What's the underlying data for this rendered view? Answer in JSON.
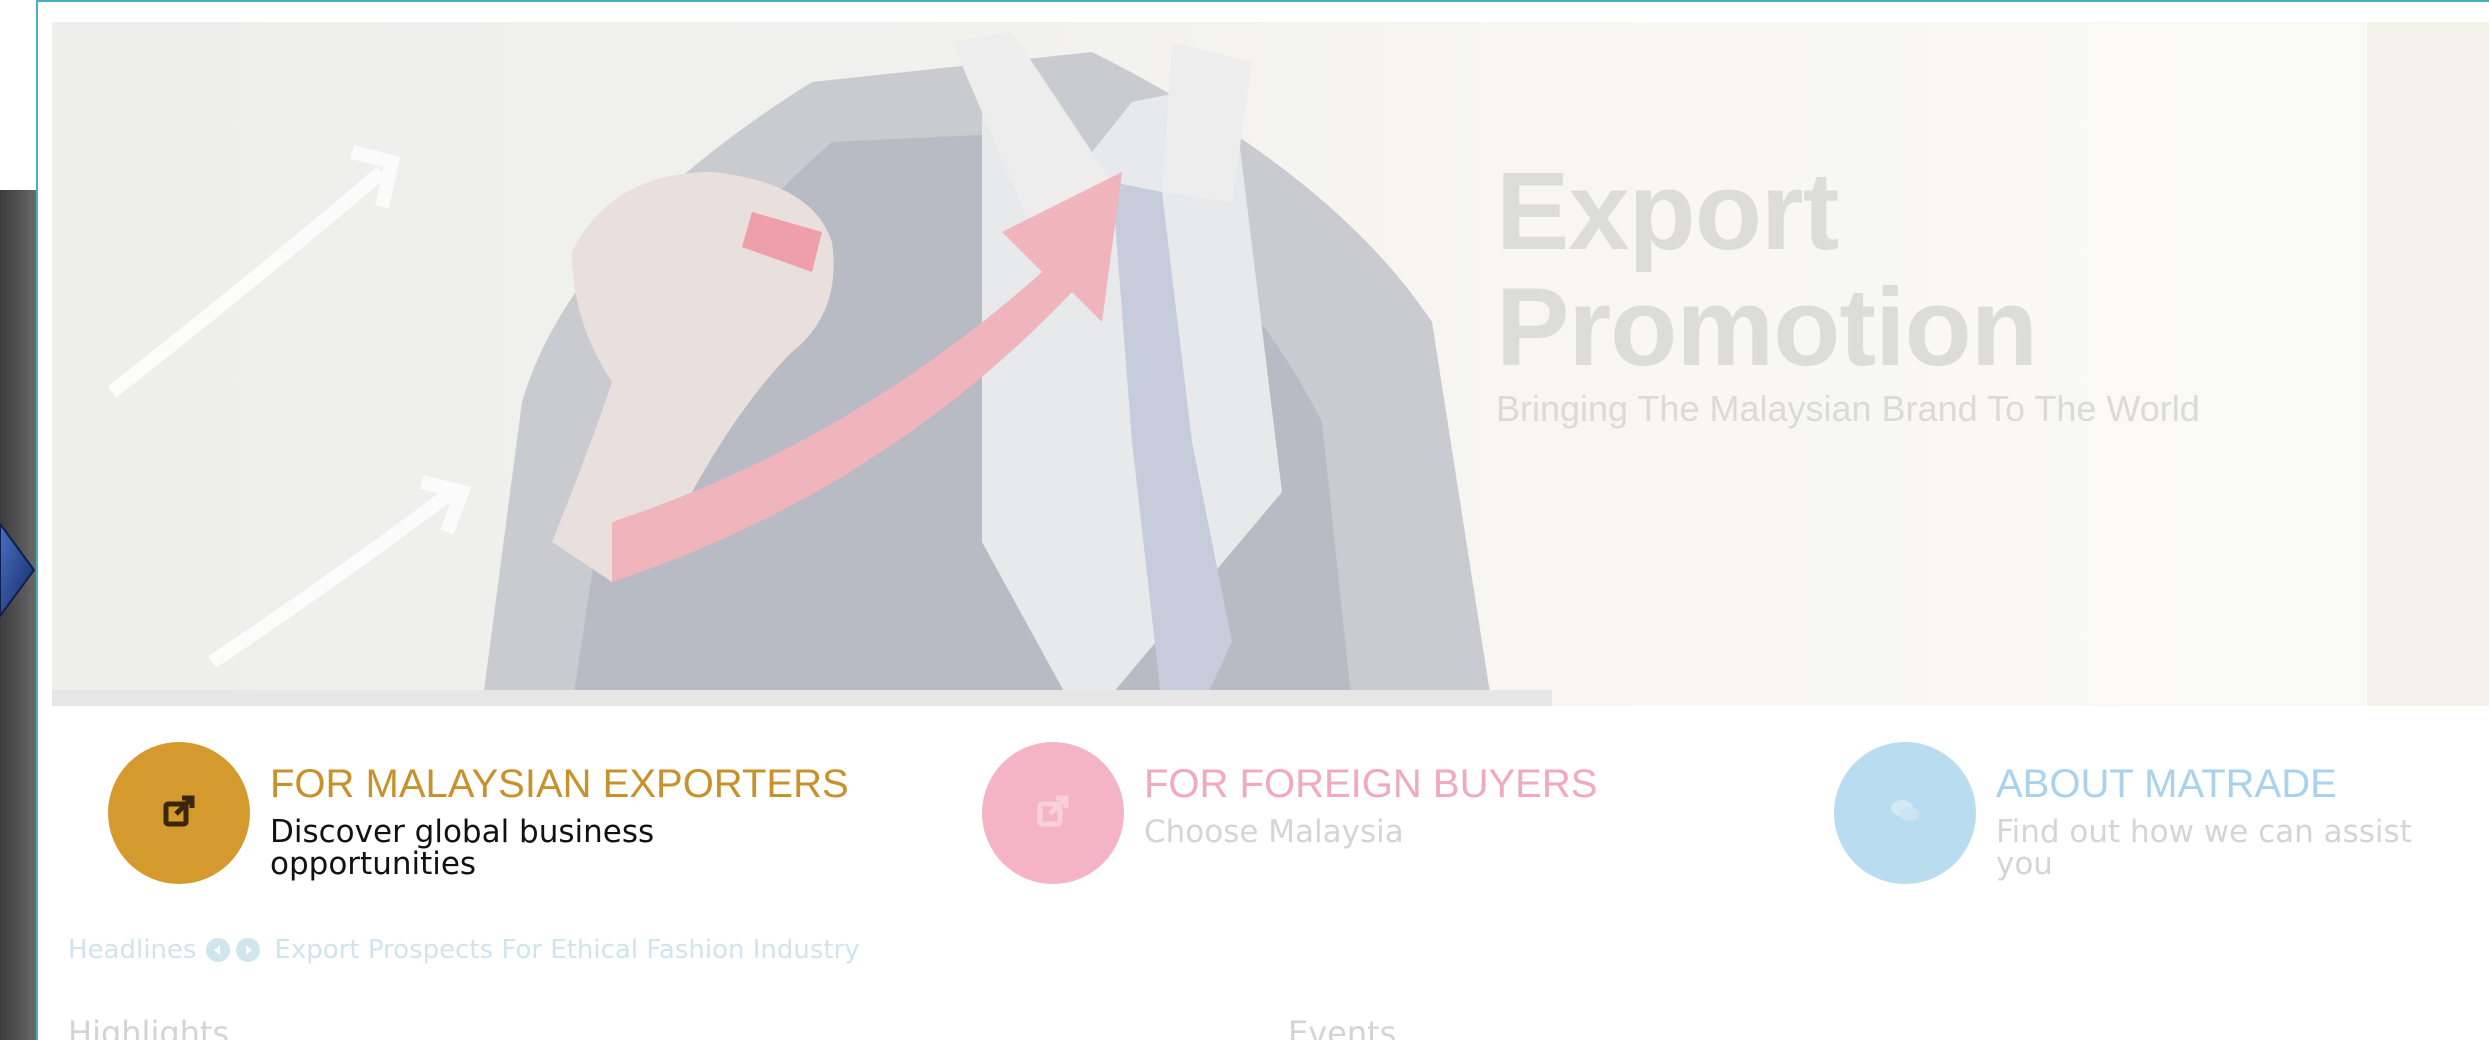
{
  "hero": {
    "title_line1": "Export",
    "title_line2": "Promotion",
    "subtitle": "Bringing The Malaysian Brand To The World"
  },
  "cards": [
    {
      "title": "FOR MALAYSIAN EXPORTERS",
      "description": "Discover global business opportunities",
      "color": "#d59a2d",
      "title_color": "#c9912b",
      "desc_color": "#111111",
      "icon": "external-link-icon"
    },
    {
      "title": "FOR FOREIGN BUYERS",
      "description": "Choose Malaysia",
      "color": "#f4b4c6",
      "title_color": "#f0a9be",
      "desc_color": "#d5d5d5",
      "icon": "external-link-icon"
    },
    {
      "title": "ABOUT MATRADE",
      "description": "Find out how we can assist you",
      "color": "#b9dcf0",
      "title_color": "#a8d2ee",
      "desc_color": "#d5d5d5",
      "icon": "chat-icon"
    }
  ],
  "headlines": {
    "label": "Headlines",
    "item": "Export Prospects For Ethical Fashion Industry"
  },
  "sections": {
    "highlights": "Highlights",
    "events": "Events"
  },
  "colors": {
    "frame_border": "#49aebf",
    "nav_arrow": "#1f3f8a"
  }
}
